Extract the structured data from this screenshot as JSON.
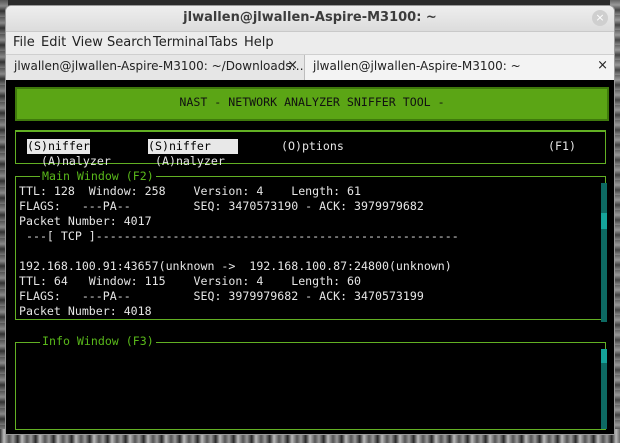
{
  "window": {
    "title": "jlwallen@jlwallen-Aspire-M3100: ~",
    "close_glyph": "×"
  },
  "menu": [
    "File",
    "Edit",
    "View",
    "Search",
    "Terminal",
    "Tabs",
    "Help"
  ],
  "tabs": [
    {
      "label": "jlwallen@jlwallen-Aspire-M3100: ~/Downloads…",
      "close": "×"
    },
    {
      "label": "jlwallen@jlwallen-Aspire-M3100: ~",
      "close": "×"
    }
  ],
  "terminal": {
    "banner": "NAST - NETWORK ANALYZER SNIFFER TOOL -",
    "menu": {
      "sniffer_selected": "(S)niffer",
      "sniffer_highlight": "(S)niffer ",
      "options": "(O)ptions",
      "f1": "(F1)",
      "analyzer_1": "(A)nalyzer",
      "analyzer_2": "(A)nalyzer"
    },
    "main_window_title": "Main Window (F2)",
    "main_lines": [
      "TTL: 128  Window: 258    Version: 4    Length: 61",
      "FLAGS:   ---PA--         SEQ: 3470573190 - ACK: 3979979682",
      "Packet Number: 4017",
      " ---[ TCP ]----------------------------------------------------",
      "",
      "192.168.100.91:43657(unknown ->  192.168.100.87:24800(unknown)",
      "TTL: 64   Window: 115    Version: 4    Length: 60",
      "FLAGS:   ---PA--         SEQ: 3979979682 - ACK: 3470573199",
      "Packet Number: 4018"
    ],
    "info_window_title": "Info Window (F3)",
    "colors": {
      "green": "#59b81a",
      "banner": "#5ba515",
      "scrollbar": "#15a39a"
    }
  }
}
